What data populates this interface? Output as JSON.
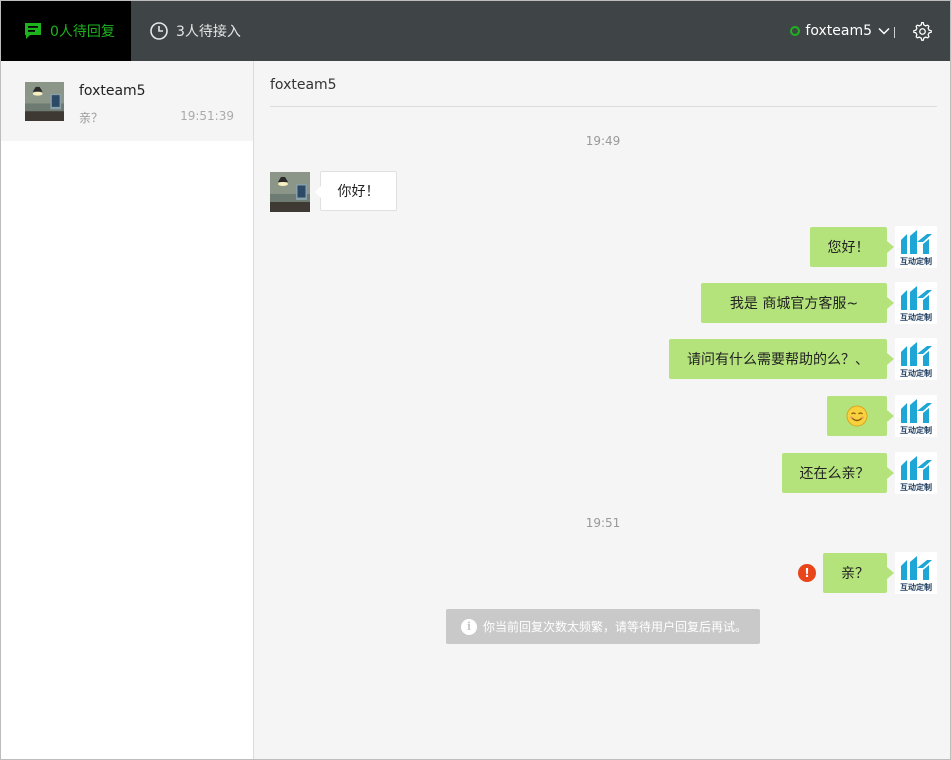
{
  "topbar": {
    "tab_replies": "0人待回复",
    "tab_queue": "3人待接入",
    "status_user": "foxteam5",
    "divider_char": "|"
  },
  "icons": {
    "tab_replies": "chat-bubble-icon",
    "tab_queue": "clock-icon",
    "status": "online-dot-icon",
    "dropdown": "chevron-down-icon",
    "settings": "gear-icon",
    "error": "error-icon",
    "info": "info-icon",
    "emoji": "smiley-emoji-icon"
  },
  "colors": {
    "topbar_bg": "#3f4447",
    "active_tab_bg": "#000000",
    "accent_green": "#1db31d",
    "bubble_out": "#b5e37b",
    "error_red": "#e8451a",
    "toast_bg": "#c9c9c9"
  },
  "sidebar": {
    "conversations": [
      {
        "name": "foxteam5",
        "preview": "亲？",
        "time": "19:51:39"
      }
    ]
  },
  "chat": {
    "title": "foxteam5",
    "time_dividers": [
      "19:49",
      "19:51"
    ],
    "messages": [
      {
        "from": "customer",
        "text": "你好！"
      },
      {
        "from": "agent",
        "text": "您好！"
      },
      {
        "from": "agent",
        "text": "我是 商城官方客服~"
      },
      {
        "from": "agent",
        "text": "请问有什么需要帮助的么？、"
      },
      {
        "from": "agent",
        "text": ""
      },
      {
        "from": "agent",
        "text": "还在么亲？"
      },
      {
        "from": "agent",
        "text": "亲？"
      }
    ],
    "agent_logo_text": "互动定制",
    "error_mark": "!",
    "toast": "你当前回复次数太频繁，请等待用户回复后再试。",
    "toast_info_mark": "i"
  }
}
